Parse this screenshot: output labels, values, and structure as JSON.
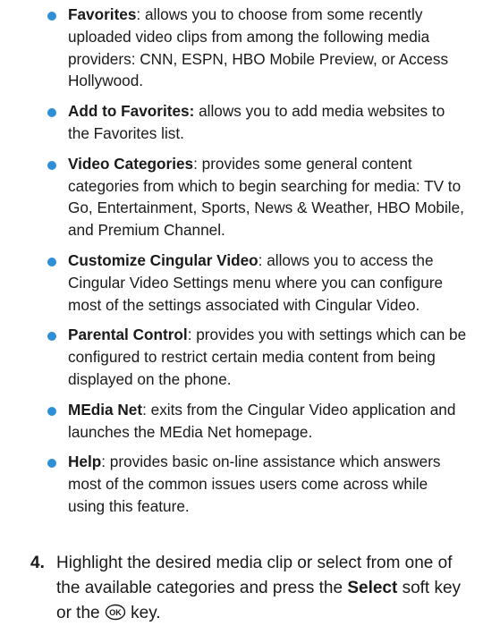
{
  "bullets": [
    {
      "term": "Favorites",
      "text": ": allows you to choose from some recently uploaded video clips from among the following media providers: CNN, ESPN, HBO Mobile Preview, or Access Hollywood."
    },
    {
      "term": "Add to Favorites:",
      "text": " allows you to add media websites to the Favorites list."
    },
    {
      "term": "Video Categories",
      "text": ": provides some general content categories from which to begin searching for media: TV to Go, Entertainment, Sports, News & Weather, HBO Mobile, and Premium Channel."
    },
    {
      "term": "Customize Cingular Video",
      "text": ": allows you to access the Cingular Video Settings menu where you can configure most of the settings associated with Cingular Video."
    },
    {
      "term": "Parental Control",
      "text": ": provides you with settings which can be configured to restrict certain media content from being displayed on the phone."
    },
    {
      "term": "MEdia Net",
      "text": ": exits from the Cingular Video application and launches the MEdia Net homepage."
    },
    {
      "term": "Help",
      "text": ": provides basic on-line assistance which answers most of the common issues users come across while using this feature."
    }
  ],
  "step": {
    "number": "4.",
    "text_before": "Highlight the desired media clip or select from one of the available categories and press the ",
    "select_label": "Select",
    "text_middle": " soft key or the ",
    "ok_key_label": "OK",
    "text_after": " key."
  },
  "colors": {
    "bullet": "#2e8ed6",
    "text": "#1a1a1a"
  }
}
